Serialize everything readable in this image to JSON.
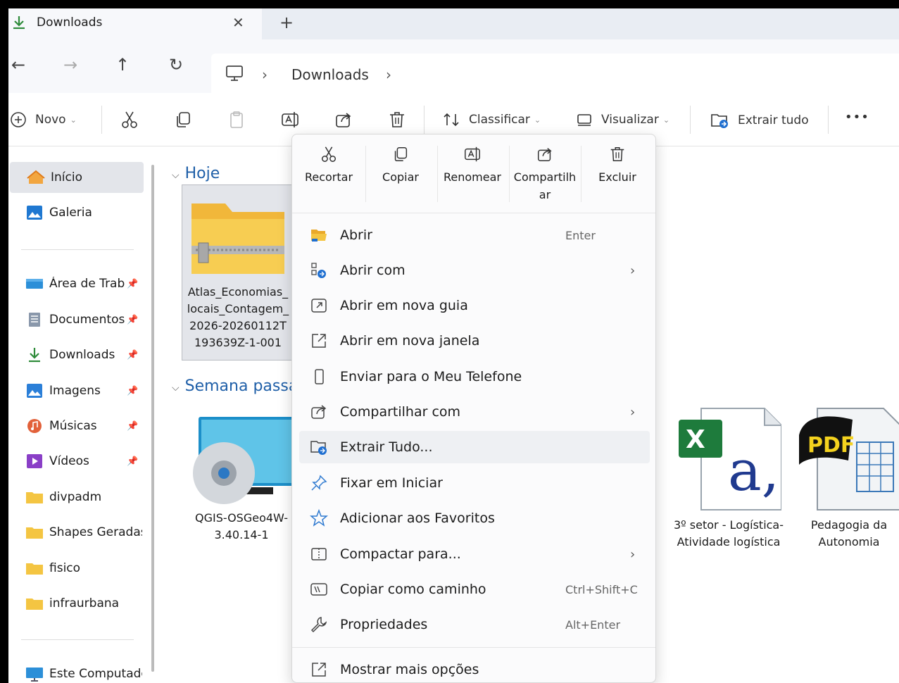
{
  "window": {
    "tab_title": "Downloads",
    "tab_close": "✕",
    "new_tab": "+"
  },
  "nav": {
    "back": "←",
    "forward": "→",
    "up": "↑",
    "refresh": "↻",
    "crumb_sep": "›",
    "breadcrumb": "Downloads"
  },
  "toolbar": {
    "new_label": "Novo",
    "sort_label": "Classificar",
    "view_label": "Visualizar",
    "extract_label": "Extrair tudo",
    "more_label": "•••"
  },
  "sidebar": {
    "items": [
      {
        "label": "Início"
      },
      {
        "label": "Galeria"
      },
      {
        "label": "Área de Trabalho"
      },
      {
        "label": "Documentos"
      },
      {
        "label": "Downloads"
      },
      {
        "label": "Imagens"
      },
      {
        "label": "Músicas"
      },
      {
        "label": "Vídeos"
      },
      {
        "label": "divpadm"
      },
      {
        "label": "Shapes Geradas"
      },
      {
        "label": "fisico"
      },
      {
        "label": "infraurbana"
      },
      {
        "label": "Este Computador"
      }
    ],
    "pin_glyph": "📌"
  },
  "content": {
    "groups": {
      "today": "Hoje",
      "last_week": "Semana passada"
    },
    "files": [
      {
        "name": "Atlas_Economias_locais_Contagem_2026-20260112T193639Z-1-001"
      },
      {
        "name": "QGIS-OSGeo4W-3.40.14-1"
      },
      {
        "name": "3º setor - Logística- Atividade logística"
      },
      {
        "name": "Pedagogia da Autonomia"
      }
    ]
  },
  "context_menu": {
    "quick_actions": [
      {
        "label": "Recortar"
      },
      {
        "label": "Copiar"
      },
      {
        "label": "Renomear"
      },
      {
        "label": "Compartilhar"
      },
      {
        "label": "Excluir"
      }
    ],
    "items": [
      {
        "label": "Abrir",
        "shortcut": "Enter"
      },
      {
        "label": "Abrir com",
        "arrow": "›"
      },
      {
        "label": "Abrir em nova guia"
      },
      {
        "label": "Abrir em nova janela"
      },
      {
        "label": "Enviar para o Meu Telefone"
      },
      {
        "label": "Compartilhar com",
        "arrow": "›"
      },
      {
        "label": "Extrair Tudo..."
      },
      {
        "label": "Fixar em Iniciar"
      },
      {
        "label": "Adicionar aos Favoritos"
      },
      {
        "label": "Compactar para...",
        "arrow": "›"
      },
      {
        "label": "Copiar como caminho",
        "shortcut": "Ctrl+Shift+C"
      },
      {
        "label": "Propriedades",
        "shortcut": "Alt+Enter"
      },
      {
        "label": "Mostrar mais opções"
      }
    ]
  },
  "colors": {
    "accent": "#1f5fa8",
    "folder": "#f4c542",
    "selection": "#e3e5ea"
  }
}
